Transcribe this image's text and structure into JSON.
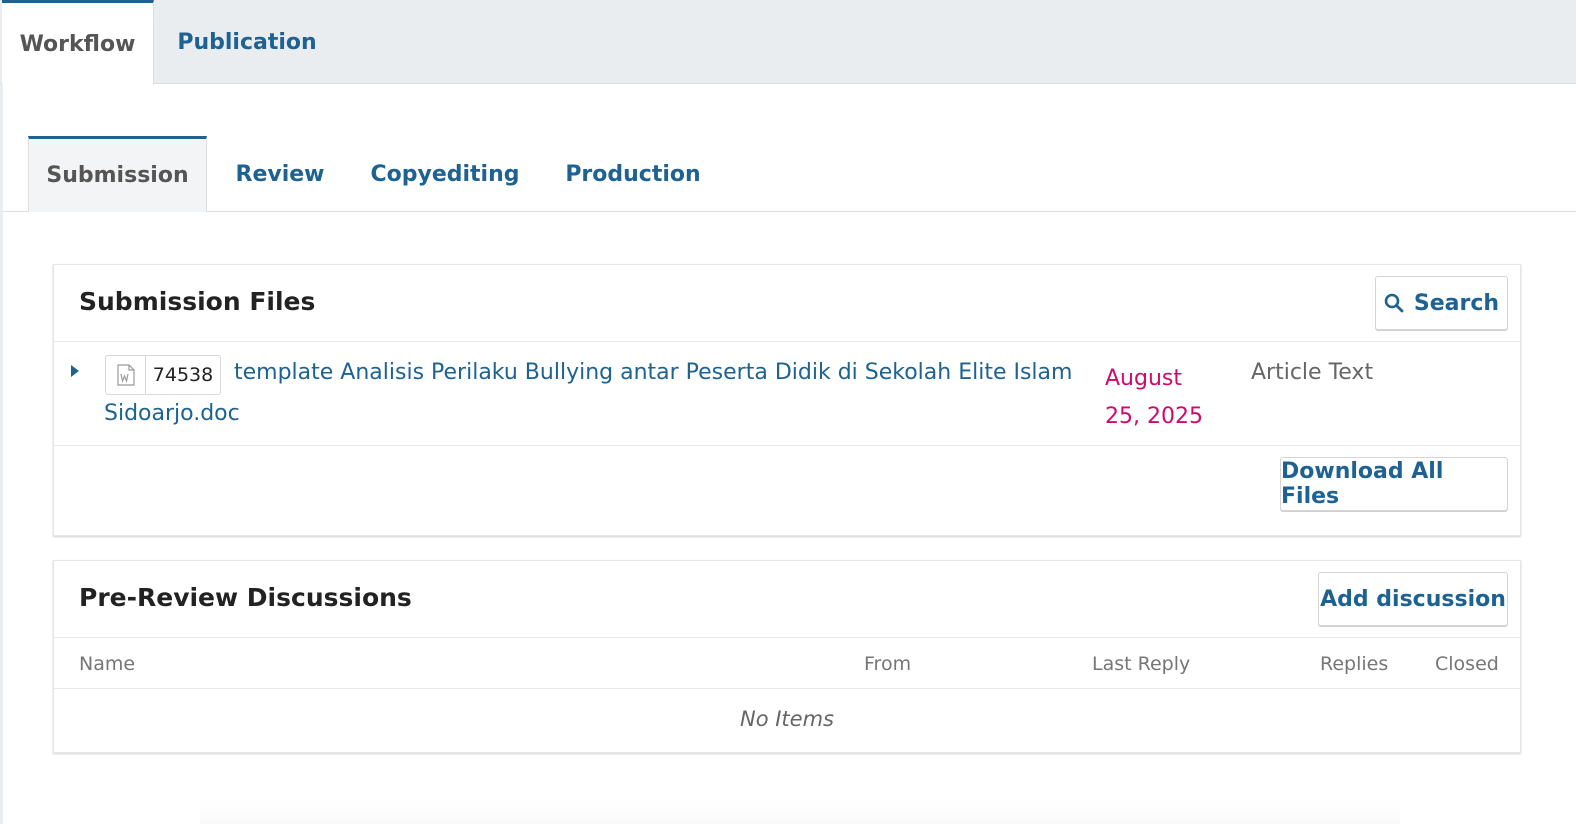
{
  "top_tabs": {
    "workflow": "Workflow",
    "publication": "Publication"
  },
  "sub_tabs": {
    "submission": "Submission",
    "review": "Review",
    "copyediting": "Copyediting",
    "production": "Production"
  },
  "submission_files": {
    "title": "Submission Files",
    "search_label": "Search",
    "file": {
      "id": "74538",
      "name_line1": "template Analisis Perilaku Bullying antar Peserta Didik di Sekolah Elite Islam",
      "name_line2": "Sidoarjo.doc",
      "date_line1": "August",
      "date_line2": "25, 2025",
      "genre": "Article Text",
      "icon": "word-document-icon"
    },
    "download_all_label": "Download All Files"
  },
  "pre_review_discussions": {
    "title": "Pre-Review Discussions",
    "add_label": "Add discussion",
    "columns": {
      "name": "Name",
      "from": "From",
      "last_reply": "Last Reply",
      "replies": "Replies",
      "closed": "Closed"
    },
    "empty_text": "No Items"
  },
  "colors": {
    "link": "#1e6292",
    "date": "#d00a6c",
    "tab_bar_bg": "#e9edef"
  }
}
